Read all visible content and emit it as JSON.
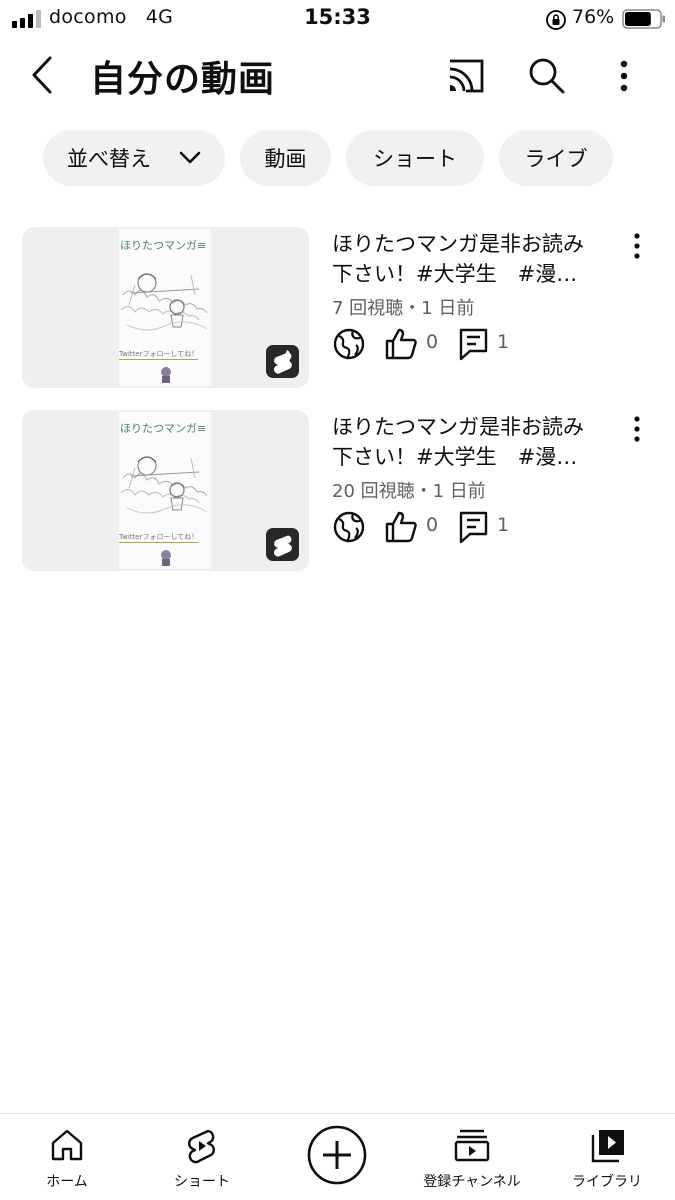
{
  "status_bar": {
    "carrier": "docomo",
    "network": "4G",
    "time": "15:33",
    "battery_percent": "76%",
    "signal_icon": "signal-bars-icon",
    "lock_icon": "orientation-lock-icon",
    "battery_icon": "battery-icon",
    "battery_level": 0.76
  },
  "app_bar": {
    "title": "自分の動画",
    "back_icon": "chevron-left-icon",
    "cast_icon": "cast-icon",
    "search_icon": "search-icon",
    "more_icon": "more-vertical-icon"
  },
  "chips": {
    "sort": "並べ替え",
    "videos": "動画",
    "shorts": "ショート",
    "live": "ライブ"
  },
  "videos": [
    {
      "title_line1": "ほりたつマンガ是非お読み",
      "title_line2": "下さい！#大学生　#漫…",
      "meta": "7 回視聴・1 日前",
      "likes": "0",
      "comments": "1",
      "thumb_title": "ほりたつマンガ≡",
      "thumb_follow": "Twitterフォローしてね！"
    },
    {
      "title_line1": "ほりたつマンガ是非お読み",
      "title_line2": "下さい！#大学生　#漫…",
      "meta": "20 回視聴・1 日前",
      "likes": "0",
      "comments": "1",
      "thumb_title": "ほりたつマンガ≡",
      "thumb_follow": "Twitterフォローしてね！"
    }
  ],
  "bottom_nav": {
    "home": "ホーム",
    "shorts": "ショート",
    "subscriptions": "登録チャンネル",
    "library": "ライブラリ"
  },
  "colors": {
    "chip_bg": "#f1f1f1",
    "thumb_bg": "#efefef",
    "text_primary": "#0f0f0f",
    "text_secondary": "#606060"
  }
}
